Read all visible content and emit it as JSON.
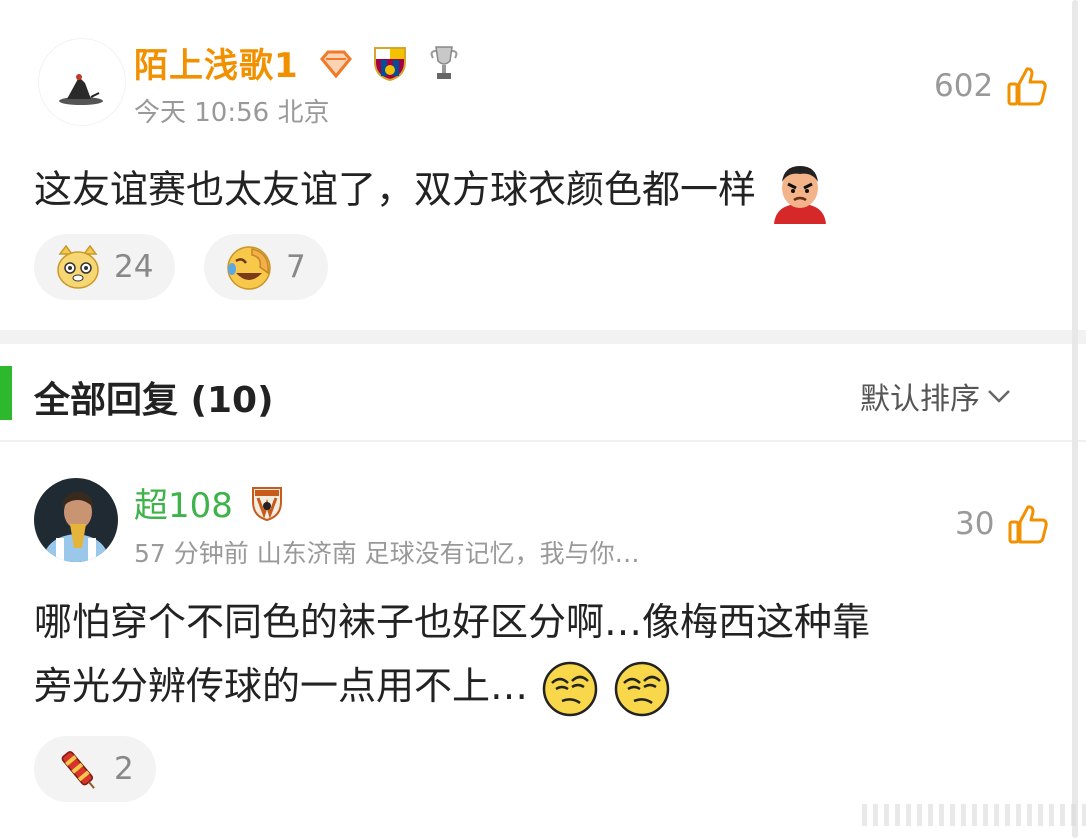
{
  "comment": {
    "username": "陌上浅歌1",
    "time": "今天 10:56",
    "location": "北京",
    "likes": "602",
    "text": "这友谊赛也太友谊了，双方球衣颜色都一样",
    "reactions": [
      {
        "icon": "cat-face-emoji-icon",
        "count": "24"
      },
      {
        "icon": "laughing-facepalm-emoji-icon",
        "count": "7"
      }
    ]
  },
  "replies_header": {
    "title": "全部回复 (10)",
    "sort_label": "默认排序"
  },
  "reply": {
    "username": "超108",
    "meta": "57 分钟前 山东济南 足球没有记忆，我与你…",
    "likes": "30",
    "text_line1": "哪怕穿个不同色的袜子也好区分啊…像梅西这种靠",
    "text_line2": "旁光分辨传球的一点用不上…",
    "reaction_count": "2"
  },
  "colors": {
    "vip_name": "#f29100",
    "green_name": "#3db34a",
    "accent_bar": "#2eb82e",
    "like_icon": "#f29100"
  }
}
